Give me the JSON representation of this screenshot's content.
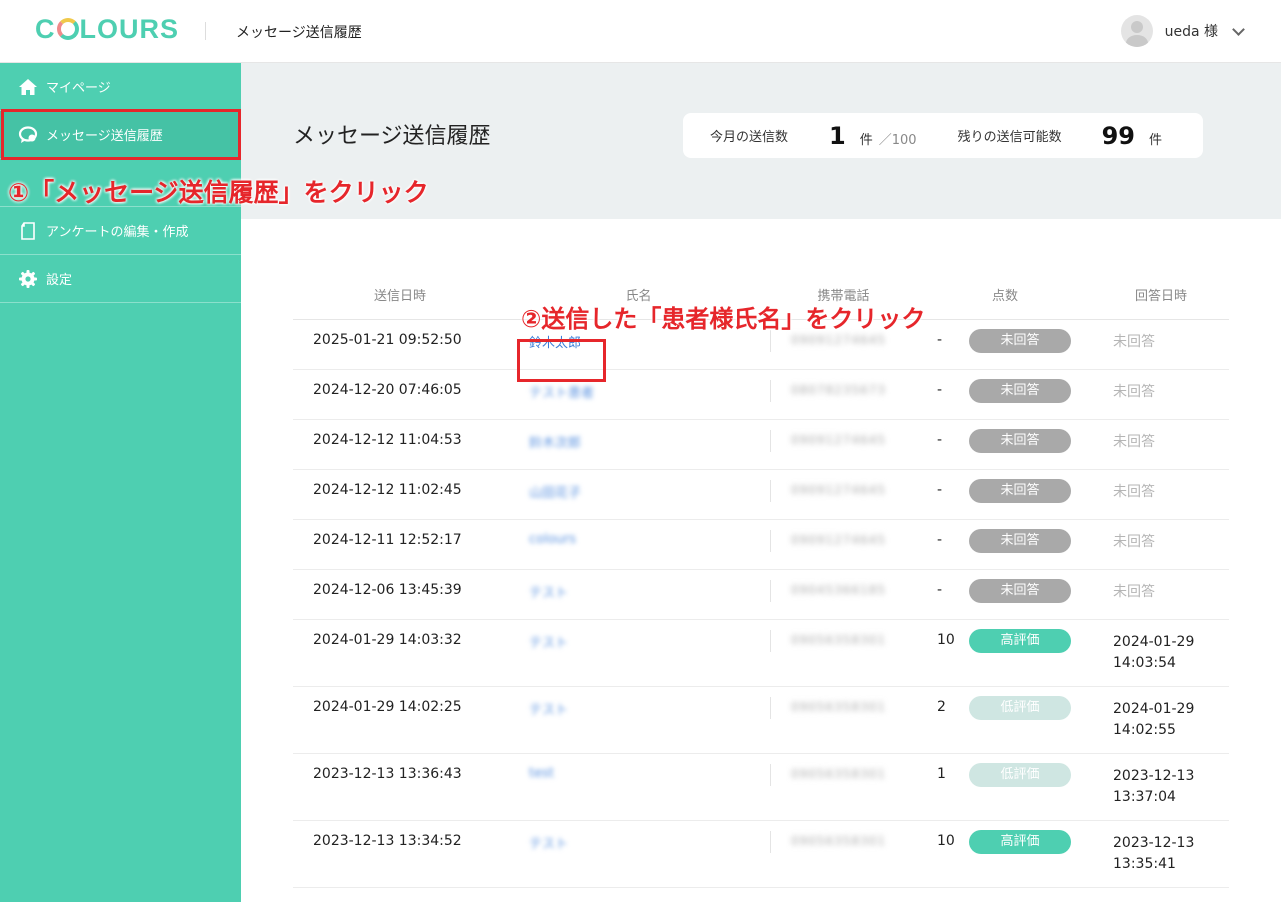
{
  "header": {
    "logo": "C",
    "logo_rest": "LOURS",
    "title": "メッセージ送信履歴",
    "user": "ueda 様"
  },
  "sidebar": {
    "items": [
      {
        "label": "マイページ",
        "icon": "home-icon"
      },
      {
        "label": "メッセージ送信履歴",
        "icon": "chat-icon"
      },
      {
        "label": "",
        "icon": ""
      },
      {
        "label": "アンケートの編集・作成",
        "icon": "document-icon"
      },
      {
        "label": "設定",
        "icon": "gear-icon"
      }
    ]
  },
  "main": {
    "title": "メッセージ送信履歴",
    "stats": {
      "monthly_label": "今月の送信数",
      "monthly_count": "1",
      "monthly_unit": "件",
      "monthly_max": "／100",
      "remaining_label": "残りの送信可能数",
      "remaining_count": "99",
      "remaining_unit": "件"
    }
  },
  "table": {
    "headers": [
      "送信日時",
      "氏名",
      "携帯電話",
      "点数",
      "回答日時"
    ],
    "rows": [
      {
        "date": "2025-01-21 09:52:50",
        "name": "鈴木太郎",
        "phone": "09091274645",
        "score": "-",
        "status": "未回答",
        "answer": "未回答"
      },
      {
        "date": "2024-12-20 07:46:05",
        "name": "テスト患者",
        "phone": "08078235673",
        "score": "-",
        "status": "未回答",
        "answer": "未回答"
      },
      {
        "date": "2024-12-12 11:04:53",
        "name": "鈴木次郎",
        "phone": "09091274645",
        "score": "-",
        "status": "未回答",
        "answer": "未回答"
      },
      {
        "date": "2024-12-12 11:02:45",
        "name": "山田花子",
        "phone": "09091274645",
        "score": "-",
        "status": "未回答",
        "answer": "未回答"
      },
      {
        "date": "2024-12-11 12:52:17",
        "name": "colours",
        "phone": "09091274645",
        "score": "-",
        "status": "未回答",
        "answer": "未回答"
      },
      {
        "date": "2024-12-06 13:45:39",
        "name": "テスト",
        "phone": "09045366185",
        "score": "-",
        "status": "未回答",
        "answer": "未回答"
      },
      {
        "date": "2024-01-29 14:03:32",
        "name": "テスト",
        "phone": "09056358301",
        "score": "10",
        "status": "高評価",
        "answer": "2024-01-29 14:03:54"
      },
      {
        "date": "2024-01-29 14:02:25",
        "name": "テスト",
        "phone": "09056358301",
        "score": "2",
        "status": "低評価",
        "answer": "2024-01-29 14:02:55"
      },
      {
        "date": "2023-12-13 13:36:43",
        "name": "test",
        "phone": "09056358301",
        "score": "1",
        "status": "低評価",
        "answer": "2023-12-13 13:37:04"
      },
      {
        "date": "2023-12-13 13:34:52",
        "name": "テスト",
        "phone": "09056358301",
        "score": "10",
        "status": "高評価",
        "answer": "2023-12-13 13:35:41"
      }
    ]
  },
  "annotations": {
    "step1": "①「メッセージ送信履歴」をクリック",
    "step2": "②送信した「患者様氏名」をクリック"
  },
  "colors": {
    "accent": "#4ecfb1",
    "annotation": "#e6262b",
    "badge_none": "#a9a9a9",
    "badge_low": "#cfe6e2"
  }
}
